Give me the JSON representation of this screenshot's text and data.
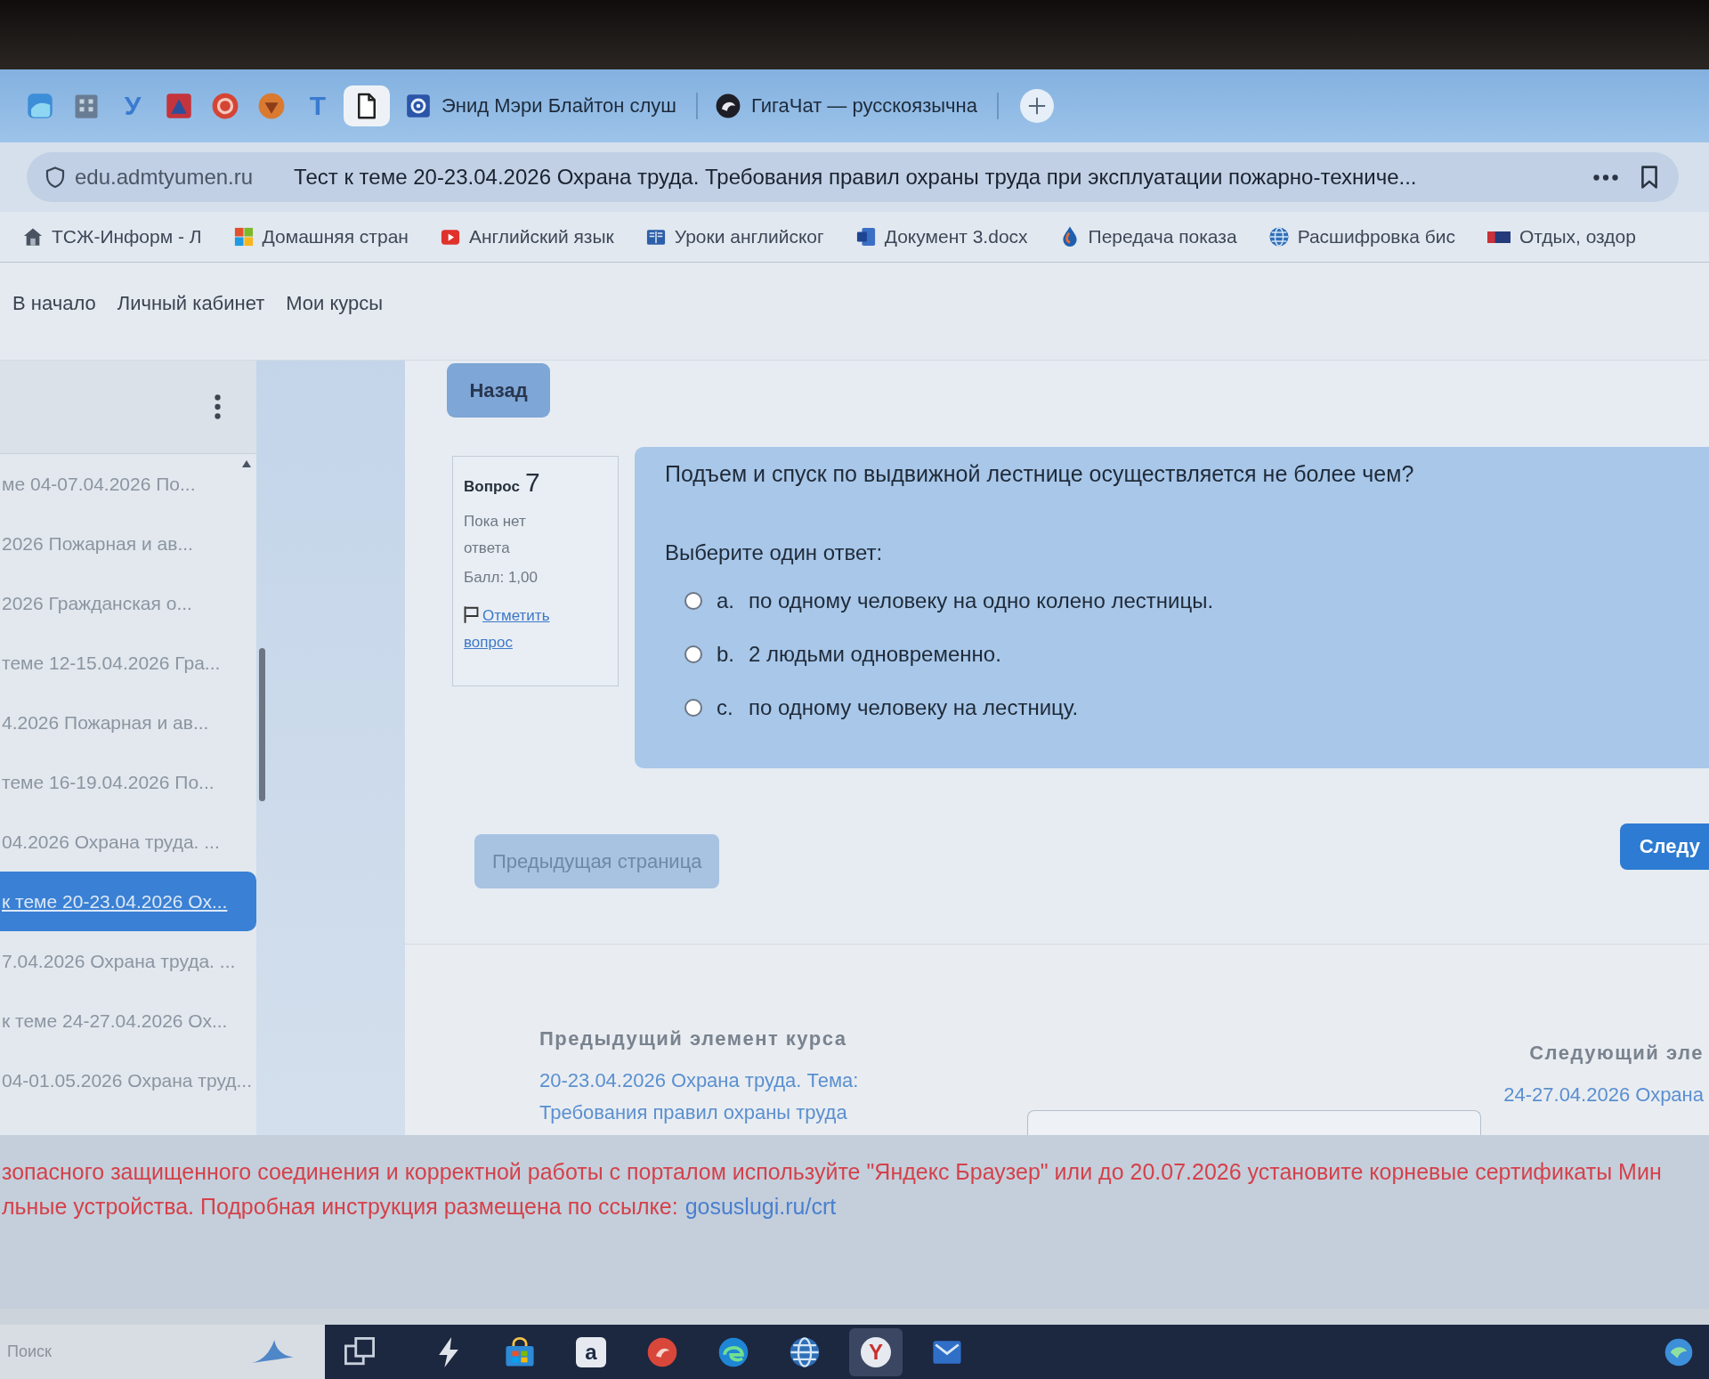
{
  "browser": {
    "pinned_tabs": [
      {
        "kind": "tile",
        "selected": false
      },
      {
        "kind": "building",
        "selected": false
      },
      {
        "kind": "glyph",
        "glyph": "У",
        "selected": false
      },
      {
        "kind": "emblem",
        "selected": false
      },
      {
        "kind": "target",
        "selected": false
      },
      {
        "kind": "crest",
        "selected": false
      },
      {
        "kind": "glyph",
        "glyph": "T",
        "selected": false
      },
      {
        "kind": "page",
        "selected": true
      }
    ],
    "tabs": [
      {
        "kind": "logo",
        "title": "Энид Мэри Блайтон слуш",
        "selected": false
      },
      {
        "kind": "orb",
        "title": "ГигаЧат — русскоязычна",
        "selected": false
      }
    ],
    "address_bar": {
      "domain": "edu.admtyumen.ru",
      "page_title": "Тест к теме 20-23.04.2026 Охрана труда. Требования правил охраны труда при эксплуатации пожарно-техниче..."
    },
    "bookmarks": [
      {
        "kind": "house",
        "label": "ТСЖ-Информ - Л"
      },
      {
        "kind": "tiles",
        "label": "Домашняя стран"
      },
      {
        "kind": "video",
        "label": "Английский язык"
      },
      {
        "kind": "book",
        "label": "Уроки английског"
      },
      {
        "kind": "doc",
        "label": "Документ 3.docx"
      },
      {
        "kind": "drop",
        "label": "Передача показа"
      },
      {
        "kind": "globe",
        "label": "Расшифровка бис"
      },
      {
        "kind": "flag",
        "label": "Отдых, оздор"
      }
    ]
  },
  "nav": [
    "В начало",
    "Личный кабинет",
    "Мои курсы"
  ],
  "sidebar": {
    "items": [
      {
        "label": "ме 04-07.04.2026 По...",
        "selected": false
      },
      {
        "label": "2026 Пожарная и ав...",
        "selected": false
      },
      {
        "label": "2026 Гражданская о...",
        "selected": false
      },
      {
        "label": "теме 12-15.04.2026 Гра...",
        "selected": false
      },
      {
        "label": "4.2026 Пожарная и ав...",
        "selected": false
      },
      {
        "label": "теме 16-19.04.2026 По...",
        "selected": false
      },
      {
        "label": "04.2026 Охрана труда. ...",
        "selected": false
      },
      {
        "label": "к теме 20-23.04.2026 Ох...",
        "selected": true
      },
      {
        "label": "7.04.2026 Охрана труда. ...",
        "selected": false
      },
      {
        "label": "к теме 24-27.04.2026 Ох...",
        "selected": false
      },
      {
        "label": "04-01.05.2026 Охрана труд...",
        "selected": false
      }
    ]
  },
  "quiz": {
    "back_button": "Назад",
    "info": {
      "label": "Вопрос",
      "number": "7",
      "status": "Пока нет ответа",
      "grade": "Балл: 1,00",
      "flag_link": "Отметить вопрос"
    },
    "question": "Подъем и спуск по выдвижной лестнице осуществляется не более чем?",
    "prompt": "Выберите один ответ:",
    "options": [
      {
        "letter": "a.",
        "text": "по одному человеку на одно колено лестницы.",
        "selected": false
      },
      {
        "letter": "b.",
        "text": "2 людьми одновременно.",
        "selected": false
      },
      {
        "letter": "c.",
        "text": "по одному человеку на лестницу.",
        "selected": false
      }
    ],
    "prev_button": "Предыдущая страница",
    "next_button": "Следу"
  },
  "course_footer": {
    "previous": {
      "heading": "Предыдущий элемент курса",
      "link_lines": [
        "20-23.04.2026 Охрана труда. Тема:",
        "Требования правил охраны труда"
      ]
    },
    "next": {
      "heading": "Следующий эле",
      "link": "24-27.04.2026 Охрана"
    }
  },
  "notice": {
    "line_1": "зопасного защищенного соединения и корректной работы с порталом используйте \"Яндекс Браузер\" или до 20.07.2026 установите корневые сертификаты Мин",
    "line_2": "льные устройства. Подробная инструкция размещена по ссылке:",
    "link": "gosuslugi.ru/crt"
  },
  "taskbar": {
    "search_placeholder": "Поиск",
    "apps": [
      {
        "kind": "tasks",
        "selected": false
      },
      {
        "kind": "bolt",
        "selected": false
      },
      {
        "kind": "bag",
        "selected": false
      },
      {
        "kind": "glyph",
        "glyph": "a",
        "selected": false
      },
      {
        "kind": "disc",
        "selected": false
      },
      {
        "kind": "swirl",
        "selected": false
      },
      {
        "kind": "globe",
        "selected": false
      },
      {
        "kind": "glyph",
        "glyph": "Y",
        "selected": true
      },
      {
        "kind": "mail",
        "selected": false
      }
    ]
  }
}
